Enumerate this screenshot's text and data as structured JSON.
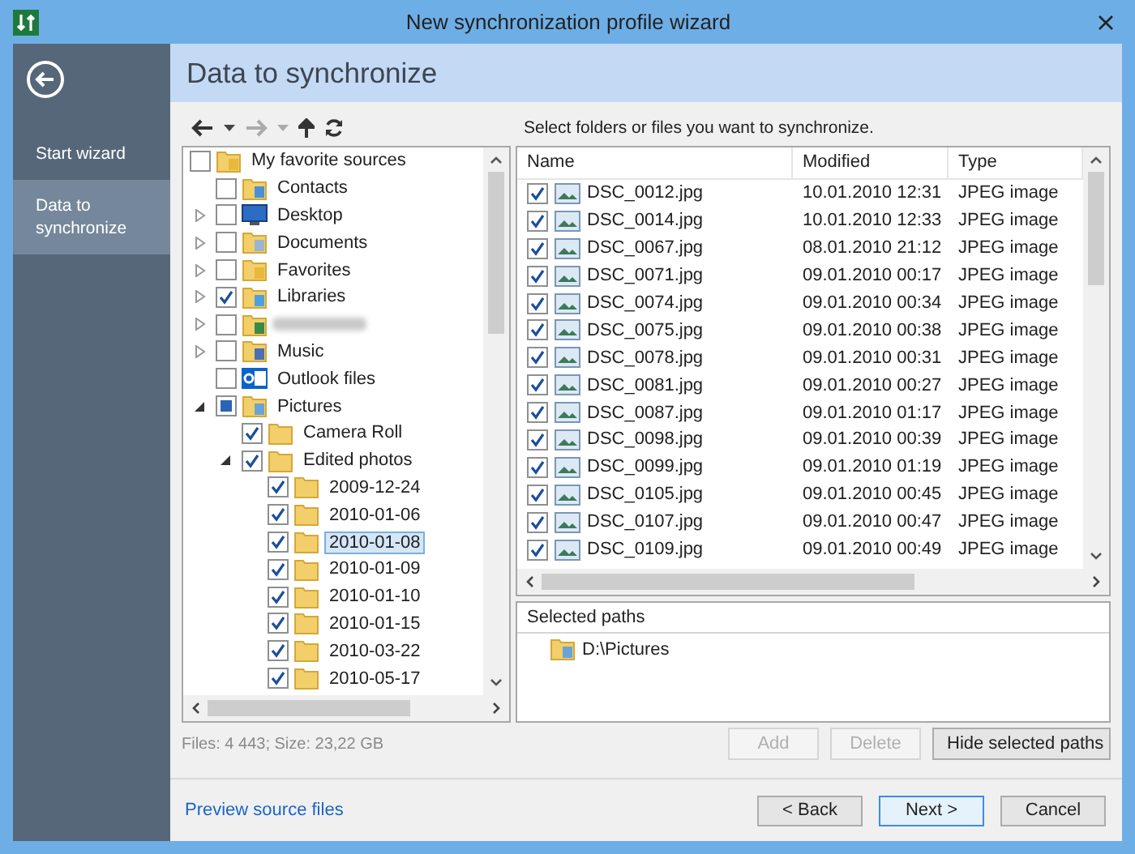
{
  "window": {
    "title": "New synchronization profile wizard"
  },
  "sidebar": {
    "items": [
      {
        "label": "Start wizard",
        "selected": false
      },
      {
        "label": "Data to synchronize",
        "selected": true
      }
    ]
  },
  "header": {
    "title": "Data to synchronize"
  },
  "instruction": "Select folders or files you want to synchronize.",
  "tree": {
    "items": [
      {
        "label": "My favorite sources",
        "kind": "favorites",
        "checked": false,
        "selected": false,
        "children": [
          {
            "label": "Contacts",
            "kind": "contacts",
            "checked": false,
            "selected": false
          },
          {
            "label": "Desktop",
            "kind": "desktop",
            "checked": false,
            "selected": false,
            "expanded": false
          },
          {
            "label": "Documents",
            "kind": "documents",
            "checked": false,
            "selected": false,
            "expanded": false
          },
          {
            "label": "Favorites",
            "kind": "favorites",
            "checked": false,
            "selected": false,
            "expanded": false
          },
          {
            "label": "Libraries",
            "kind": "libraries",
            "checked": true,
            "selected": false,
            "expanded": false
          },
          {
            "kind": "hidden",
            "checked": false,
            "selected": false,
            "expanded": false
          },
          {
            "label": "Music",
            "kind": "music",
            "checked": false,
            "selected": false,
            "expanded": false
          },
          {
            "label": "Outlook files",
            "kind": "outlook",
            "checked": false,
            "selected": false
          },
          {
            "label": "Pictures",
            "kind": "pictures",
            "checked": false,
            "partial": true,
            "selected": false,
            "expanded": true,
            "children": [
              {
                "label": "Camera Roll",
                "kind": "folder",
                "checked": true,
                "selected": false
              },
              {
                "label": "Edited photos",
                "kind": "folder",
                "checked": true,
                "selected": false,
                "expanded": true,
                "children": [
                  {
                    "label": "2009-12-24",
                    "kind": "folder",
                    "checked": true,
                    "selected": false
                  },
                  {
                    "label": "2010-01-06",
                    "kind": "folder",
                    "checked": true,
                    "selected": false
                  },
                  {
                    "label": "2010-01-08",
                    "kind": "folder",
                    "checked": true,
                    "selected": true
                  },
                  {
                    "label": "2010-01-09",
                    "kind": "folder",
                    "checked": true,
                    "selected": false
                  },
                  {
                    "label": "2010-01-10",
                    "kind": "folder",
                    "checked": true,
                    "selected": false
                  },
                  {
                    "label": "2010-01-15",
                    "kind": "folder",
                    "checked": true,
                    "selected": false
                  },
                  {
                    "label": "2010-03-22",
                    "kind": "folder",
                    "checked": true,
                    "selected": false
                  },
                  {
                    "label": "2010-05-17",
                    "kind": "folder",
                    "checked": true,
                    "selected": false
                  }
                ]
              }
            ]
          }
        ]
      }
    ]
  },
  "files": {
    "columns": [
      "Name",
      "Modified",
      "Type"
    ],
    "rows": [
      {
        "name": "DSC_0012.jpg",
        "modified": "10.01.2010 12:31",
        "type": "JPEG image",
        "checked": true
      },
      {
        "name": "DSC_0014.jpg",
        "modified": "10.01.2010 12:33",
        "type": "JPEG image",
        "checked": true
      },
      {
        "name": "DSC_0067.jpg",
        "modified": "08.01.2010 21:12",
        "type": "JPEG image",
        "checked": true
      },
      {
        "name": "DSC_0071.jpg",
        "modified": "09.01.2010 00:17",
        "type": "JPEG image",
        "checked": true
      },
      {
        "name": "DSC_0074.jpg",
        "modified": "09.01.2010 00:34",
        "type": "JPEG image",
        "checked": true
      },
      {
        "name": "DSC_0075.jpg",
        "modified": "09.01.2010 00:38",
        "type": "JPEG image",
        "checked": true
      },
      {
        "name": "DSC_0078.jpg",
        "modified": "09.01.2010 00:31",
        "type": "JPEG image",
        "checked": true
      },
      {
        "name": "DSC_0081.jpg",
        "modified": "09.01.2010 00:27",
        "type": "JPEG image",
        "checked": true
      },
      {
        "name": "DSC_0087.jpg",
        "modified": "09.01.2010 01:17",
        "type": "JPEG image",
        "checked": true
      },
      {
        "name": "DSC_0098.jpg",
        "modified": "09.01.2010 00:39",
        "type": "JPEG image",
        "checked": true
      },
      {
        "name": "DSC_0099.jpg",
        "modified": "09.01.2010 01:19",
        "type": "JPEG image",
        "checked": true
      },
      {
        "name": "DSC_0105.jpg",
        "modified": "09.01.2010 00:45",
        "type": "JPEG image",
        "checked": true
      },
      {
        "name": "DSC_0107.jpg",
        "modified": "09.01.2010 00:47",
        "type": "JPEG image",
        "checked": true
      },
      {
        "name": "DSC_0109.jpg",
        "modified": "09.01.2010 00:49",
        "type": "JPEG image",
        "checked": true
      }
    ]
  },
  "selected_paths": {
    "title": "Selected paths",
    "items": [
      "D:\\Pictures"
    ]
  },
  "path_buttons": [
    {
      "label": "Add",
      "disabled": true
    },
    {
      "label": "Delete",
      "disabled": true
    },
    {
      "label": "Hide selected paths",
      "disabled": false
    }
  ],
  "status": "Files: 4 443; Size: 23,22 GB",
  "footer": {
    "link": "Preview source files",
    "buttons": [
      {
        "label": "< Back",
        "default": false
      },
      {
        "label": "Next >",
        "default": true
      },
      {
        "label": "Cancel",
        "default": false
      }
    ]
  }
}
